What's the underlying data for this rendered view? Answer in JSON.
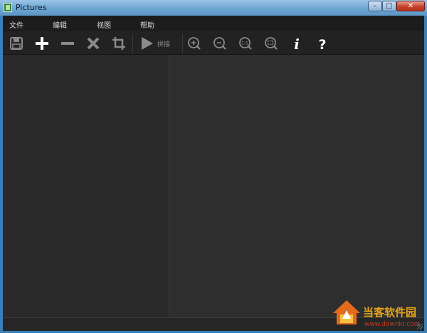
{
  "window": {
    "title": "Pictures",
    "controls": {
      "minimize": "–",
      "maximize": "□",
      "close": "✕"
    }
  },
  "menu": [
    "文件",
    "编辑",
    "视图",
    "帮助"
  ],
  "toolbar": {
    "buttons": [
      {
        "icon": "save-icon"
      },
      {
        "icon": "plus-icon"
      },
      {
        "icon": "minus-icon"
      },
      {
        "icon": "x-icon"
      },
      {
        "icon": "crop-icon"
      },
      {
        "icon": "play-icon"
      },
      {
        "icon": "zoom-in-icon"
      },
      {
        "icon": "zoom-out-icon"
      },
      {
        "icon": "zoom-actual-icon",
        "text": "1:1"
      },
      {
        "icon": "zoom-fit-icon"
      },
      {
        "icon": "info-icon",
        "text": "i"
      },
      {
        "icon": "help-icon",
        "text": "?"
      }
    ],
    "stitch_label": "拼接"
  },
  "watermark": {
    "text": "当客软件园",
    "url": "www.downkr.com"
  },
  "colors": {
    "menu_text": "#dcdcdc",
    "icon_bright": "#ffffff",
    "icon_dim": "#8a8a8a",
    "pane_bg": "#2a2a2a",
    "viewer_bg": "#2e2e2e",
    "watermark": "#e7a51b"
  }
}
